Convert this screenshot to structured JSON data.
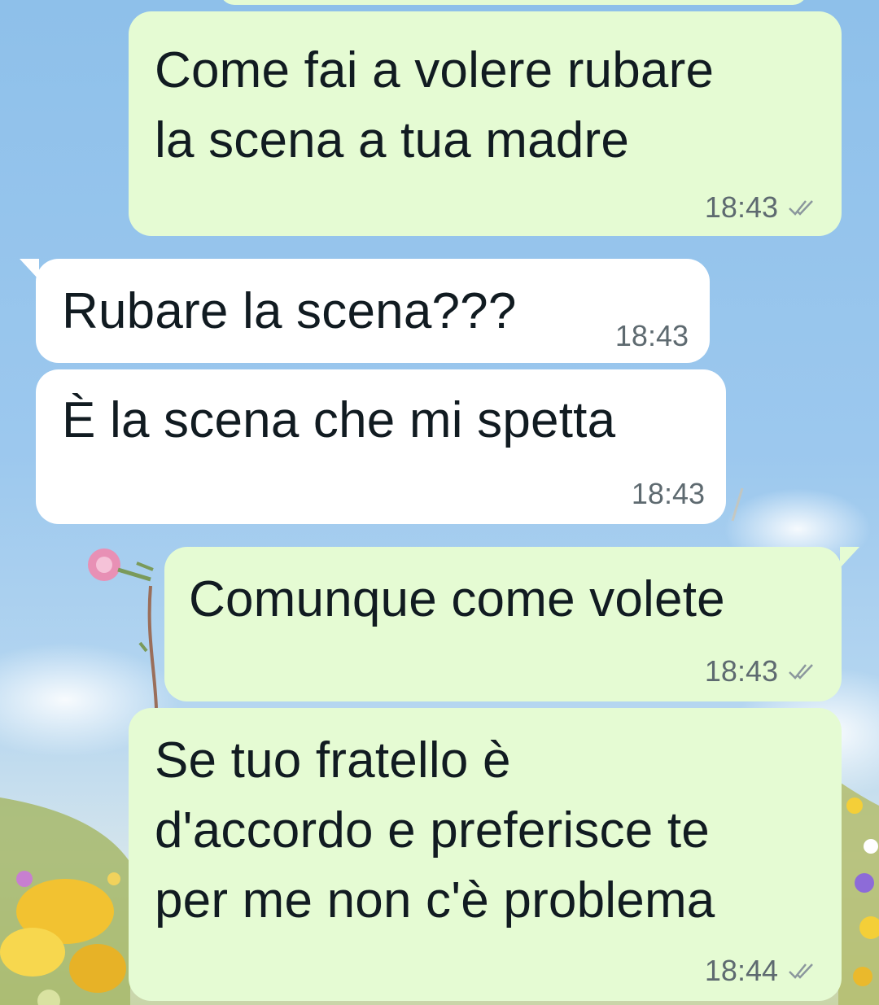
{
  "conversation": {
    "messages": [
      {
        "direction": "out",
        "text": "Come fai a volere rubare\nla scena a tua madre",
        "time": "18:43",
        "status": "read-ticks-icon"
      },
      {
        "direction": "in",
        "text": "Rubare la scena???",
        "time": "18:43"
      },
      {
        "direction": "in",
        "text": "È la scena che mi spetta",
        "time": "18:43"
      },
      {
        "direction": "out",
        "text": "Comunque come volete",
        "time": "18:43",
        "status": "read-ticks-icon"
      },
      {
        "direction": "out",
        "text": "Se tuo fratello è\nd'accordo e preferisce te\nper me non c'è problema",
        "time": "18:44",
        "status": "read-ticks-icon"
      }
    ]
  },
  "colors": {
    "outgoing_bubble": "#e5fbd3",
    "incoming_bubble": "#ffffff",
    "text": "#111b21",
    "meta": "#5e6a70",
    "wallpaper_sky": "#8ec0ea"
  }
}
